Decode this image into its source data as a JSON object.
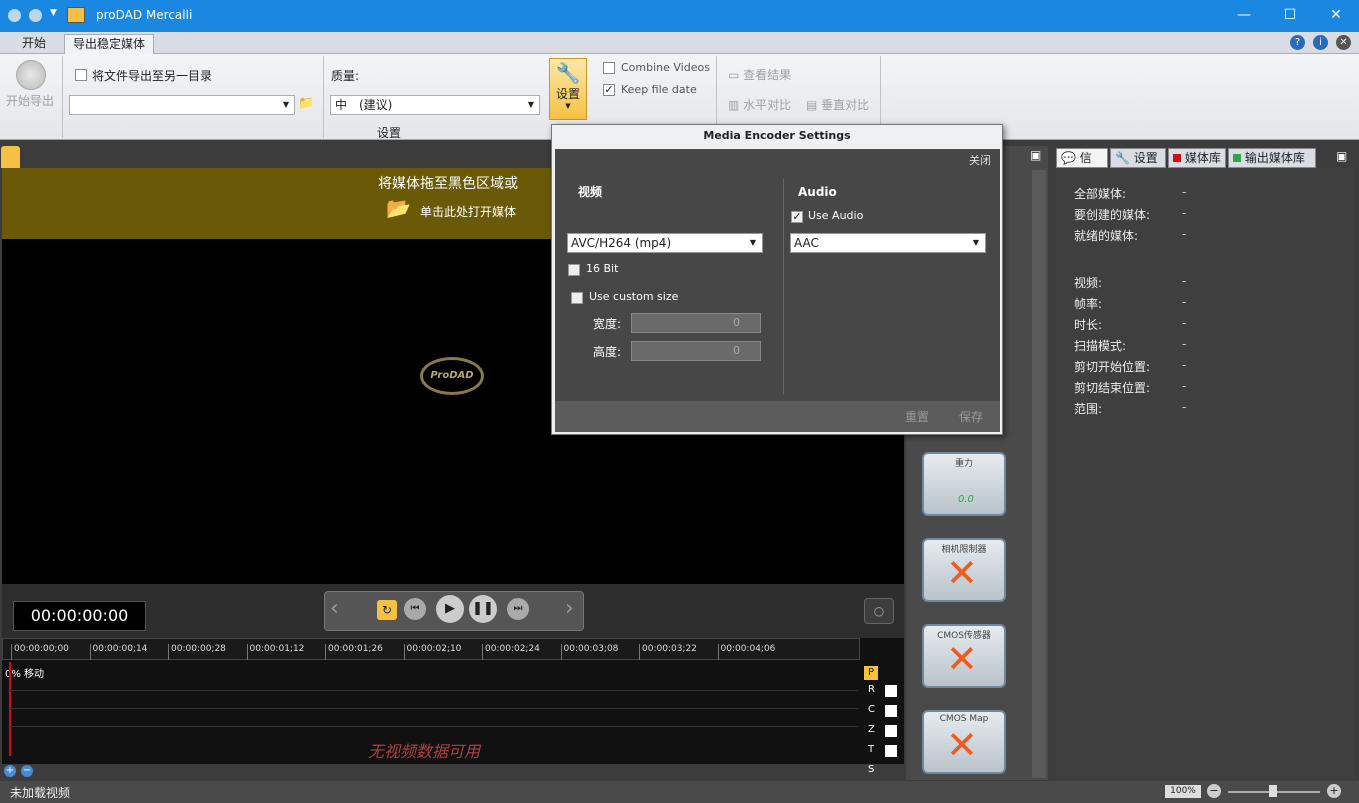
{
  "window": {
    "title": "proDAD Mercalli"
  },
  "ribbon_tabs": [
    "开始",
    "导出稳定媒体"
  ],
  "ribbon": {
    "start_export": "开始导出",
    "export_to_other_dir": "将文件导出至另一目录",
    "quality_label": "质量:",
    "quality_value": "中　(建议)",
    "group_label": "设置",
    "settings_button": "设置",
    "combine_videos": "Combine Videos",
    "keep_file_date": "Keep file date",
    "view_result": "查看结果",
    "horizontal_compare": "水平对比",
    "vertical_compare": "垂直对比"
  },
  "preview": {
    "drop_text": "将媒体拖至黑色区域或",
    "open_media": "单击此处打开媒体",
    "logo_text": "ProDAD",
    "timecode": "00:00:00:00"
  },
  "timeline": {
    "ticks": [
      "00:00:00;00",
      "00:00:00;14",
      "00:00:00;28",
      "00:00:01;12",
      "00:00:01;26",
      "00:00:02;10",
      "00:00:02;24",
      "00:00:03;08",
      "00:00:03;22",
      "00:00:04;06"
    ],
    "track_label": "0% 移动",
    "no_data": "无视频数据可用",
    "side_letters": [
      "P",
      "R",
      "C",
      "Z",
      "T",
      "S"
    ]
  },
  "tiles": [
    "重力",
    "相机限制器",
    "CMOS传感器",
    "CMOS Map"
  ],
  "tile_value": "0.0",
  "right_tabs": [
    "信息",
    "设置",
    "媒体库",
    "输出媒体库"
  ],
  "info_rows": [
    {
      "label": "全部媒体:",
      "value": "-"
    },
    {
      "label": "要创建的媒体:",
      "value": "-"
    },
    {
      "label": "就绪的媒体:",
      "value": "-"
    },
    {
      "label": "视频:",
      "value": "-"
    },
    {
      "label": "帧率:",
      "value": "-"
    },
    {
      "label": "时长:",
      "value": "-"
    },
    {
      "label": "扫描模式:",
      "value": "-"
    },
    {
      "label": "剪切开始位置:",
      "value": "-"
    },
    {
      "label": "剪切结束位置:",
      "value": "-"
    },
    {
      "label": "范围:",
      "value": "-"
    }
  ],
  "dialog": {
    "title": "Media Encoder Settings",
    "close": "关闭",
    "video_heading": "视频",
    "audio_heading": "Audio",
    "video_codec": "AVC/H264 (mp4)",
    "bit16": "16 Bit",
    "custom_size": "Use custom size",
    "width_label": "宽度:",
    "height_label": "高度:",
    "width_value": "0",
    "height_value": "0",
    "use_audio": "Use Audio",
    "audio_codec": "AAC",
    "reset": "重置",
    "save": "保存"
  },
  "status": {
    "text": "未加载视频",
    "zoom": "100%"
  }
}
